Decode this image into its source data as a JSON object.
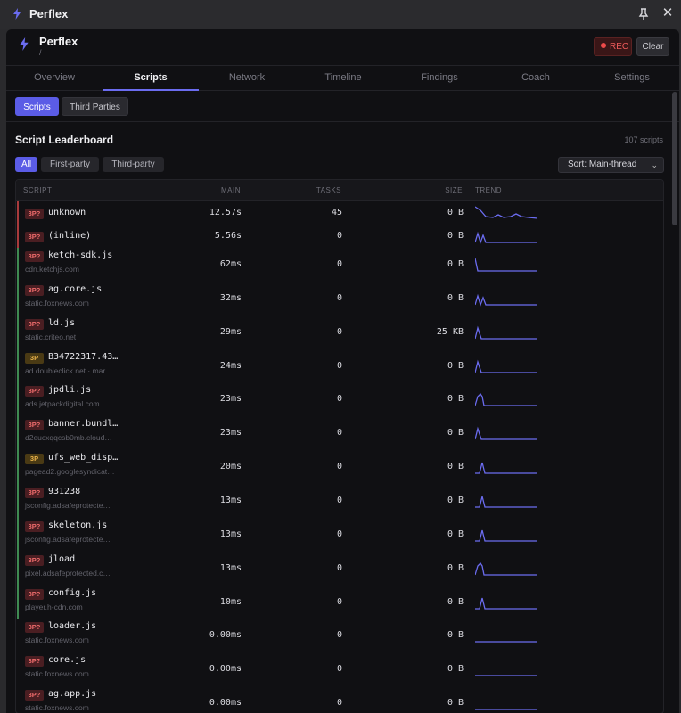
{
  "window": {
    "title": "Perflex"
  },
  "header": {
    "app_name": "Perflex",
    "path": "/",
    "rec_label": "REC",
    "clear_label": "Clear"
  },
  "tabs": [
    "Overview",
    "Scripts",
    "Network",
    "Timeline",
    "Findings",
    "Coach",
    "Settings"
  ],
  "active_tab": "Scripts",
  "subtabs": [
    "Scripts",
    "Third Parties"
  ],
  "active_subtab": "Scripts",
  "leaderboard": {
    "title": "Script Leaderboard",
    "count": "107 scripts"
  },
  "filters": [
    "All",
    "First-party",
    "Third-party"
  ],
  "active_filter": "All",
  "sort": {
    "label": "Sort: Main-thread"
  },
  "columns": {
    "script": "SCRIPT",
    "main": "MAIN",
    "tasks": "TASKS",
    "size": "SIZE",
    "trend": "TREND"
  },
  "colors": {
    "accent": "#5b5ce6",
    "trend": "#6b6cf0",
    "bar_red": "#a83a3c",
    "bar_green": "#3f8a52"
  },
  "rows": [
    {
      "badge": "3P?",
      "name": "unknown",
      "domain": "",
      "main": "12.57s",
      "tasks": "45",
      "size": "0 B",
      "bar": "red",
      "trend": "decay-multi"
    },
    {
      "badge": "3P?",
      "name": "(inline)",
      "domain": "",
      "main": "5.56s",
      "tasks": "0",
      "size": "0 B",
      "bar": "red",
      "trend": "zigzag"
    },
    {
      "badge": "3P?",
      "name": "ketch-sdk.js",
      "domain": "cdn.ketchjs.com",
      "main": "62ms",
      "tasks": "0",
      "size": "0 B",
      "bar": "green",
      "trend": "drop"
    },
    {
      "badge": "3P?",
      "name": "ag.core.js",
      "domain": "static.foxnews.com",
      "main": "32ms",
      "tasks": "0",
      "size": "0 B",
      "bar": "green",
      "trend": "zigzag"
    },
    {
      "badge": "3P?",
      "name": "ld.js",
      "domain": "static.criteo.net",
      "main": "29ms",
      "tasks": "0",
      "size": "25 KB",
      "bar": "green",
      "trend": "spike"
    },
    {
      "badge": "3P",
      "name": "B34722317.43…",
      "domain": "ad.doubleclick.net · mar…",
      "main": "24ms",
      "tasks": "0",
      "size": "0 B",
      "bar": "green",
      "trend": "spike"
    },
    {
      "badge": "3P?",
      "name": "jpdli.js",
      "domain": "ads.jetpackdigital.com",
      "main": "23ms",
      "tasks": "0",
      "size": "0 B",
      "bar": "green",
      "trend": "hump"
    },
    {
      "badge": "3P?",
      "name": "banner.bundl…",
      "domain": "d2eucxqqcsb0mb.cloud…",
      "main": "23ms",
      "tasks": "0",
      "size": "0 B",
      "bar": "green",
      "trend": "spike"
    },
    {
      "badge": "3P",
      "name": "ufs_web_disp…",
      "domain": "pagead2.googlesyndicat…",
      "main": "20ms",
      "tasks": "0",
      "size": "0 B",
      "bar": "green",
      "trend": "spike-mid"
    },
    {
      "badge": "3P?",
      "name": "931238",
      "domain": "jsconfig.adsafeprotecte…",
      "main": "13ms",
      "tasks": "0",
      "size": "0 B",
      "bar": "green",
      "trend": "spike-mid"
    },
    {
      "badge": "3P?",
      "name": "skeleton.js",
      "domain": "jsconfig.adsafeprotecte…",
      "main": "13ms",
      "tasks": "0",
      "size": "0 B",
      "bar": "green",
      "trend": "spike-mid"
    },
    {
      "badge": "3P?",
      "name": "jload",
      "domain": "pixel.adsafeprotected.c…",
      "main": "13ms",
      "tasks": "0",
      "size": "0 B",
      "bar": "green",
      "trend": "hump"
    },
    {
      "badge": "3P?",
      "name": "config.js",
      "domain": "player.h-cdn.com",
      "main": "10ms",
      "tasks": "0",
      "size": "0 B",
      "bar": "green",
      "trend": "spike-mid"
    },
    {
      "badge": "3P?",
      "name": "loader.js",
      "domain": "static.foxnews.com",
      "main": "0.00ms",
      "tasks": "0",
      "size": "0 B",
      "bar": "none",
      "trend": "flat"
    },
    {
      "badge": "3P?",
      "name": "core.js",
      "domain": "static.foxnews.com",
      "main": "0.00ms",
      "tasks": "0",
      "size": "0 B",
      "bar": "none",
      "trend": "flat"
    },
    {
      "badge": "3P?",
      "name": "ag.app.js",
      "domain": "static.foxnews.com",
      "main": "0.00ms",
      "tasks": "0",
      "size": "0 B",
      "bar": "none",
      "trend": "flat"
    }
  ]
}
